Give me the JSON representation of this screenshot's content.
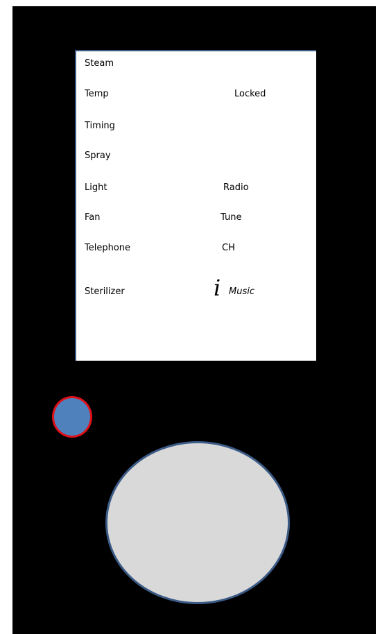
{
  "screen": {
    "left_column": [
      {
        "key": "steam",
        "label": "Steam"
      },
      {
        "key": "temp",
        "label": "Temp"
      },
      {
        "key": "timing",
        "label": "Timing"
      },
      {
        "key": "spray",
        "label": "Spray"
      },
      {
        "key": "light",
        "label": "Light"
      },
      {
        "key": "fan",
        "label": "Fan"
      },
      {
        "key": "telephone",
        "label": "Telephone"
      },
      {
        "key": "sterilizer",
        "label": "Sterilizer"
      }
    ],
    "right_column": {
      "locked": "Locked",
      "radio": "Radio",
      "tune": "Tune",
      "ch": "CH",
      "info_glyph": "i",
      "music": "Music"
    }
  },
  "controls": {
    "small_button_color": "#4f81bd",
    "small_button_border": "#e0101a",
    "large_dial_color": "#d9d9d9",
    "large_dial_border": "#3b5a86"
  }
}
